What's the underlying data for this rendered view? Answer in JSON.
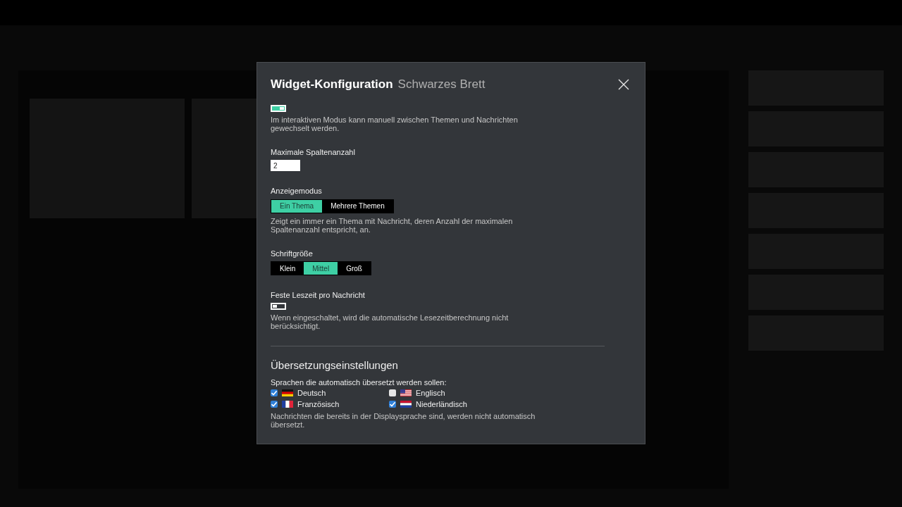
{
  "dialog": {
    "title": "Widget-Konfiguration",
    "subtitle": "Schwarzes Brett",
    "settings": [
      {
        "kind": "toggle",
        "on": true,
        "help": "Im interaktiven Modus kann manuell zwischen Themen und Nachrichten gewechselt werden."
      },
      {
        "kind": "number",
        "label": "Maximale Spaltenanzahl",
        "value": "2"
      },
      {
        "kind": "segmented",
        "label": "Anzeigemodus",
        "options": [
          {
            "label": "Ein Thema",
            "selected": true
          },
          {
            "label": "Mehrere Themen",
            "selected": false
          }
        ],
        "help": "Zeigt ein immer ein Thema mit Nachricht, deren Anzahl der maximalen Spaltenanzahl entspricht, an."
      },
      {
        "kind": "segmented",
        "label": "Schriftgröße",
        "options": [
          {
            "label": "Klein",
            "selected": false
          },
          {
            "label": "Mittel",
            "selected": true
          },
          {
            "label": "Groß",
            "selected": false
          }
        ]
      },
      {
        "kind": "toggle",
        "label": "Feste Leszeit pro Nachricht",
        "on": false,
        "help": "Wenn eingeschaltet, wird die automatische Lesezeitberechnung nicht berücksichtigt."
      }
    ],
    "translation": {
      "heading": "Übersetzungseinstellungen",
      "prompt": "Sprachen die automatisch übersetzt werden sollen:",
      "languages": [
        {
          "name": "Deutsch",
          "checked": true,
          "kind": "de"
        },
        {
          "name": "Englisch",
          "checked": false,
          "kind": "us"
        },
        {
          "name": "Französisch",
          "checked": true,
          "kind": "fr"
        },
        {
          "name": "Niederländisch",
          "checked": true,
          "kind": "nl"
        }
      ],
      "note": "Nachrichten die bereits in der Displaysprache sind, werden nicht automatisch übersetzt."
    }
  }
}
